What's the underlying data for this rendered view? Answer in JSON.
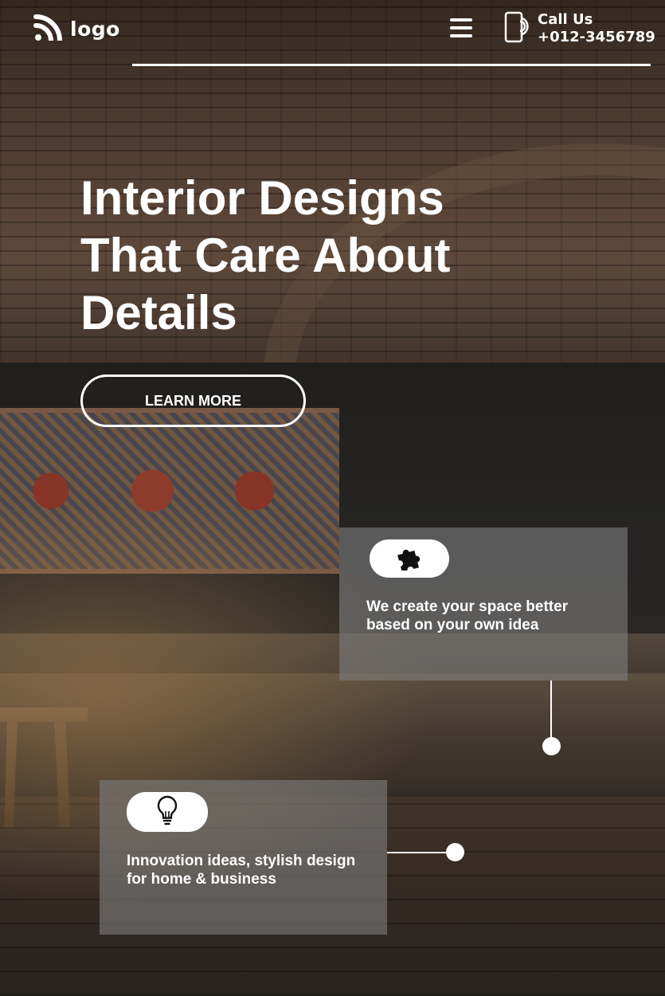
{
  "header": {
    "logo_text": "logo",
    "call_label": "Call Us",
    "call_number": "+012-3456789"
  },
  "hero": {
    "title_line1": "Interior Designs",
    "title_line2": "That Care About",
    "title_line3": "Details",
    "cta_label": "LEARN MORE"
  },
  "features": [
    {
      "icon": "puzzle-icon",
      "text_line1": "We create your space better",
      "text_line2": "based on your own idea"
    },
    {
      "icon": "lightbulb-icon",
      "text_line1": "Innovation ideas, stylish design",
      "text_line2": "for home & business"
    }
  ],
  "colors": {
    "text": "#ffffff",
    "card_overlay": "#7d7d7d",
    "pill": "#ffffff",
    "icon": "#111111"
  }
}
